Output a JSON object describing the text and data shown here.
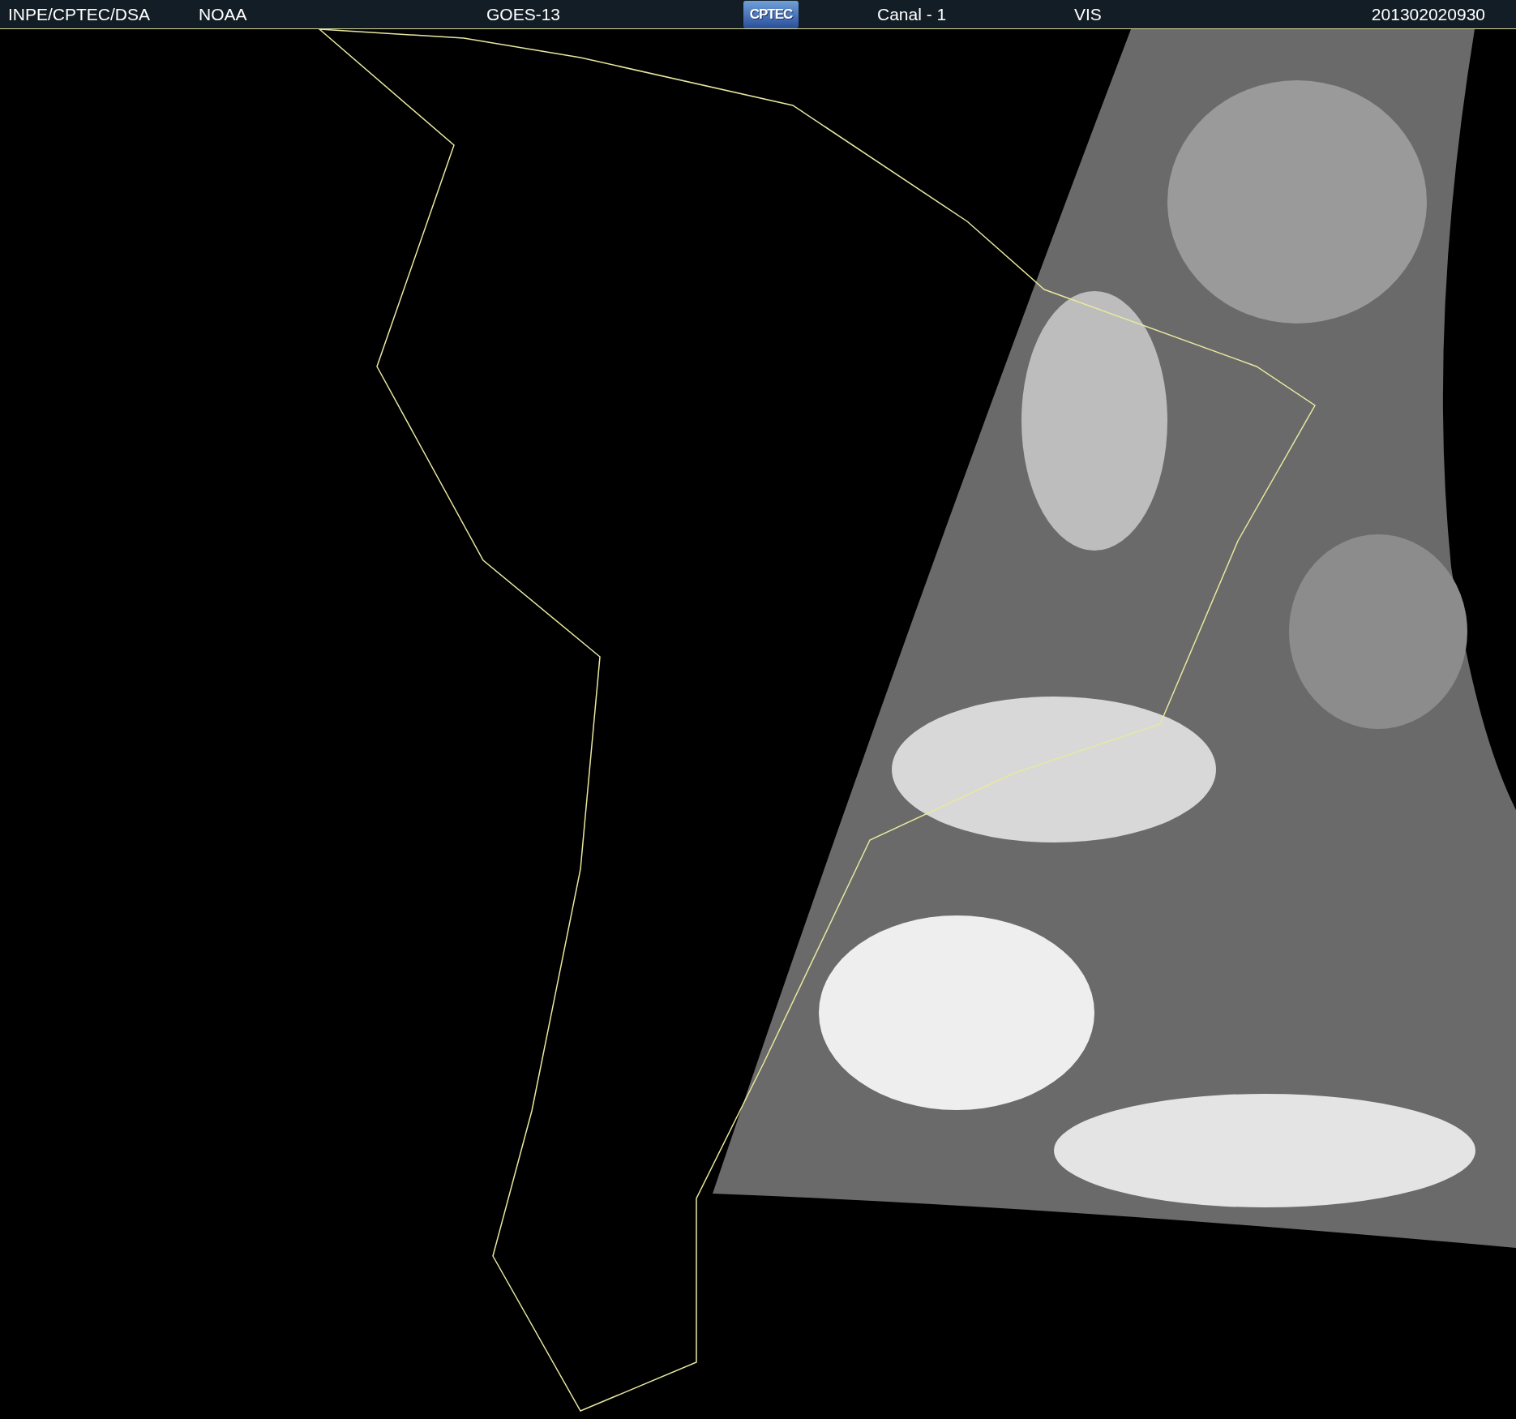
{
  "header": {
    "source": "INPE/CPTEC/DSA",
    "agency": "NOAA",
    "satellite": "GOES-13",
    "logo": "CPTEC",
    "channel": "Canal - 1",
    "band": "VIS",
    "timestamp": "201302020930"
  }
}
